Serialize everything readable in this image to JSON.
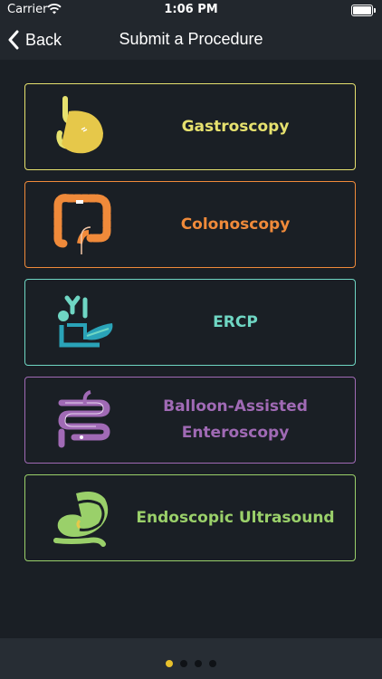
{
  "status": {
    "carrier": "Carrier",
    "time": "1:06 PM"
  },
  "nav": {
    "back_label": "Back",
    "title": "Submit a Procedure"
  },
  "procedures": [
    {
      "label": "Gastroscopy",
      "color": "#e6e16e",
      "icon": "stomach-icon"
    },
    {
      "label": "Colonoscopy",
      "color": "#f08a3a",
      "icon": "colon-icon"
    },
    {
      "label": "ERCP",
      "color": "#6fd6c3",
      "icon": "pancreas-duct-icon"
    },
    {
      "label": "Balloon-Assisted Enteroscopy",
      "color": "#a06ab5",
      "icon": "small-intestine-icon"
    },
    {
      "label": "Endoscopic Ultrasound",
      "color": "#9ad06a",
      "icon": "ultrasound-stomach-icon"
    }
  ],
  "pager": {
    "total": 4,
    "active": 0,
    "active_color": "#e8c12c"
  }
}
